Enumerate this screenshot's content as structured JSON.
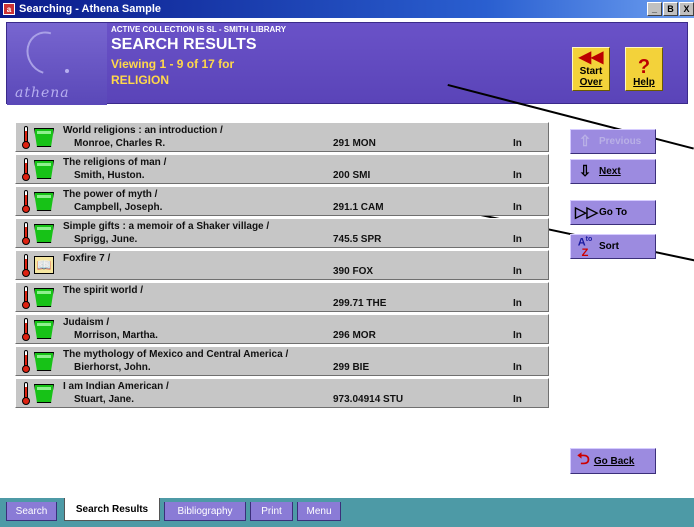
{
  "window": {
    "title": "Searching - Athena Sample",
    "controls": [
      "_",
      "B",
      "X"
    ]
  },
  "header": {
    "logo_text": "athena",
    "collection": "ACTIVE COLLECTION IS SL - SMITH LIBRARY",
    "title": "SEARCH RESULTS",
    "viewing": "Viewing 1 - 9 of 17 for",
    "query": "RELIGION",
    "start_over": {
      "line1": "Start",
      "line2": "Over"
    },
    "help": "Help"
  },
  "results": [
    {
      "title": "World religions : an introduction /",
      "author": "Monroe, Charles R.",
      "call": "291 MON",
      "status": "In",
      "icon": "bucket"
    },
    {
      "title": "The religions of man /",
      "author": "Smith, Huston.",
      "call": "200 SMI",
      "status": "In",
      "icon": "bucket"
    },
    {
      "title": "The power of myth /",
      "author": "Campbell, Joseph.",
      "call": "291.1 CAM",
      "status": "In",
      "icon": "bucket"
    },
    {
      "title": "Simple gifts : a memoir of a Shaker village /",
      "author": "Sprigg, June.",
      "call": "745.5 SPR",
      "status": "In",
      "icon": "bucket"
    },
    {
      "title": "Foxfire 7 /",
      "author": "",
      "call": "390 FOX",
      "status": "In",
      "icon": "book"
    },
    {
      "title": "The spirit world /",
      "author": "",
      "call": "299.71 THE",
      "status": "In",
      "icon": "bucket"
    },
    {
      "title": "Judaism /",
      "author": "Morrison, Martha.",
      "call": "296 MOR",
      "status": "In",
      "icon": "bucket"
    },
    {
      "title": "The mythology of Mexico and Central America /",
      "author": "Bierhorst, John.",
      "call": "299 BIE",
      "status": "In",
      "icon": "bucket"
    },
    {
      "title": "I am Indian American /",
      "author": "Stuart, Jane.",
      "call": "973.04914 STU",
      "status": "In",
      "icon": "bucket"
    }
  ],
  "side_buttons": {
    "previous": "Previous",
    "next": "Next",
    "goto": "Go To",
    "sort": "Sort",
    "sort_icon_top": "A",
    "sort_icon_to": "to",
    "sort_icon_bottom": "Z",
    "goback": "Go Back"
  },
  "tabs": [
    {
      "label": "Search",
      "active": false
    },
    {
      "label": "Search Results",
      "active": true
    },
    {
      "label": "Bibliography",
      "active": false
    },
    {
      "label": "Print",
      "active": false
    },
    {
      "label": "Menu",
      "active": false
    }
  ]
}
